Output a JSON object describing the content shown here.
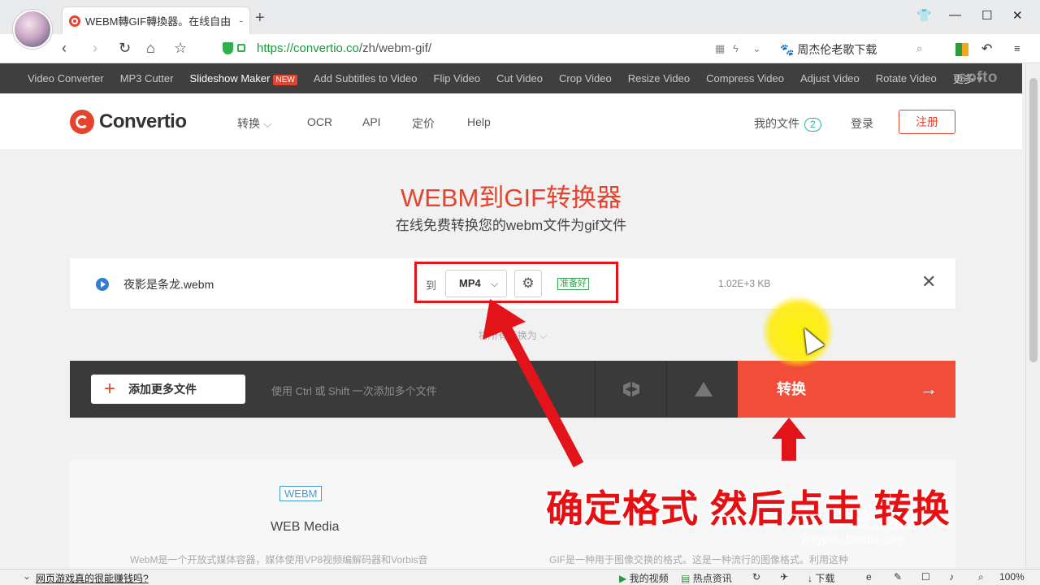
{
  "browser": {
    "tab_title": "WEBM轉GIF轉換器。在线自由",
    "tab_close": "-",
    "new_tab": "+",
    "url_host": "https://convertio.co",
    "url_path": "/zh/webm-gif/",
    "search_engine_label": "周杰伦老歌下载"
  },
  "strip": {
    "items": [
      "Video Converter",
      "MP3 Cutter",
      "Slideshow Maker",
      "Add Subtitles to Video",
      "Flip Video",
      "Cut Video",
      "Crop Video",
      "Resize Video",
      "Compress Video",
      "Adjust Video",
      "Rotate Video"
    ],
    "new_badge": "NEW",
    "more": "更多 ▾",
    "brand": "softo"
  },
  "header": {
    "logo": "Convertio",
    "menu": [
      "转换",
      "OCR",
      "API",
      "定价",
      "Help"
    ],
    "menu_chevron": "⌵",
    "my_files": "我的文件",
    "my_files_count": "2",
    "login": "登录",
    "register": "注册"
  },
  "hero": {
    "title": "WEBM到GIF转换器",
    "subtitle": "在线免费转换您的webm文件为gif文件"
  },
  "file": {
    "name": "夜影是条龙.webm",
    "to_label": "到",
    "format": "MP4",
    "status": "准备好",
    "size": "1.02E+3 KB",
    "convert_all": "将所有转换为"
  },
  "actionbar": {
    "add_more": "添加更多文件",
    "hint": "使用 Ctrl 或 Shift 一次添加多个文件",
    "convert": "转换"
  },
  "info": {
    "webm_tag": "WEBM",
    "webm_name": "WEB Media",
    "webm_desc": "WebM是一个开放式媒体容器，媒体使用VP8视频编解码器和Vorbis音",
    "gif_desc": "GIF是一种用于图像交换的格式。这是一种流行的图像格式。利用这种"
  },
  "annotation": {
    "caption": "确定格式 然后点击 转换",
    "watermark": "Bai 经验",
    "watermark_url": "jingyan.baidu.com"
  },
  "statusbar": {
    "news": "网页游戏真的很能赚钱吗?",
    "my_video": "我的视频",
    "hot_news": "热点资讯",
    "download": "下载",
    "zoom": "100%"
  },
  "colors": {
    "brand_red": "#e4432e",
    "convert_red": "#f24d38",
    "annotation_red": "#e2141a"
  }
}
